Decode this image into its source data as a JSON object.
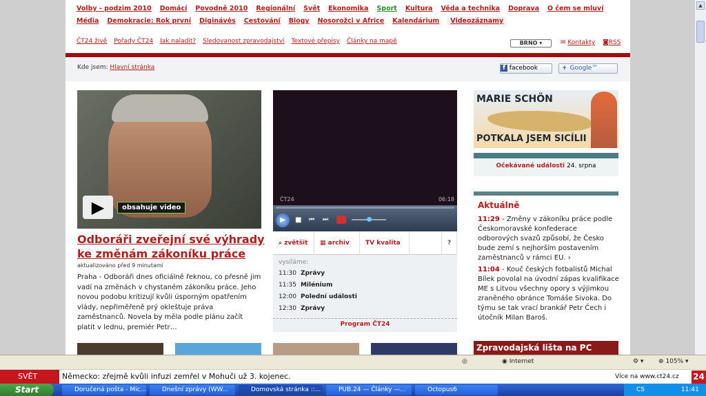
{
  "topnav1": [
    "Volby - podzim 2010",
    "Domácí",
    "Povodně 2010",
    "Regionální",
    "Svět",
    "Ekonomika",
    "Sport",
    "Kultura",
    "Věda a technika",
    "Doprava",
    "O čem se mluví"
  ],
  "topnav2": [
    "Média",
    "Demokracie: Rok první",
    "Diginávės",
    "Cestování",
    "Blogy",
    "Nosorožci v Africe",
    "Kalendárium",
    "Videozáznamy"
  ],
  "subnav": [
    "ČT24 živě",
    "Pořady ČT24",
    "Jak naladit?",
    "Sledovanost zpravodajství",
    "Textové přepisy",
    "Články na mapě"
  ],
  "region": "BRNO",
  "contacts": "Kontakty",
  "rss": "RSS",
  "crumb": {
    "label": "Kde jsem:",
    "link": "Hlavní stránka"
  },
  "share": {
    "facebook": "facebook",
    "google": "Google™"
  },
  "hero": {
    "badge": "obsahuje video",
    "title": "Odboráři zveřejní své výhrady ke změnám zákoníku práce",
    "updated": "aktualizováno před 9 minutami",
    "text": "Praha - Odboráři dnes oficiálně řeknou, co přesně jim vadí na změnách v chystaném zákoníku práce. Jeho novou podobu kritizují kvůli úsporným opatřením vlády, nepřiměřeně prý okleštuje práva zaměstnanců. Novela by měla podle plánu začít platit v lednu, premiér Petr…"
  },
  "player": {
    "channel": "ČT24",
    "time": "06:18"
  },
  "tools": [
    "zvětšit",
    "archiv",
    "TV kvalita",
    "?"
  ],
  "schedule": {
    "heading": "vysíláme:",
    "rows": [
      {
        "t": "11:30",
        "n": "Zprávy"
      },
      {
        "t": "11:35",
        "n": "Milénium"
      },
      {
        "t": "12:00",
        "n": "Polední události"
      },
      {
        "t": "12:30",
        "n": "Zprávy"
      }
    ],
    "link": "Program ČT24"
  },
  "promo": {
    "name": "MARIE SCHÖN",
    "caption": "POTKALA JSEM SICÍLII"
  },
  "events": {
    "label": "Očekávané události",
    "date": "24. srpna"
  },
  "aktualne": {
    "title": "Aktuálně",
    "items": [
      {
        "time": "11:29",
        "text": "Změny v zákoníku práce podle Českomoravské konfederace odborových svazů způsobí, že Česko bude zemí s nejhorším postavením zaměstnanců v rámci EU."
      },
      {
        "time": "11:04",
        "text": "Kouč českých fotbalistů Michal Bílek povolal na úvodní zápas kvalifikace ME s Litvou všechny opory s výjimkou zraněného obránce Tomáše Sivoka. Do týmu se tak vrací brankář Petr Čech i útočník Milan Baroš."
      }
    ]
  },
  "banner": "Zpravodajská lišta na PC",
  "status": {
    "zone": "Internet",
    "zoom": "105%"
  },
  "ticker": {
    "label": "SVĚT",
    "text": "Německo: zřejmě kvůli infuzi zemřel v Mohuči už 3. kojenec.",
    "more": "Více na www.ct24.cz",
    "logo": "24"
  },
  "taskbar": {
    "start": "Start",
    "tasks": [
      "Doručená pošta - Mic...",
      "Dnešní zprávy (WW...",
      "Domovská stránka ::...",
      "PUB.24 — Články —...",
      "Octopus6"
    ],
    "lang": "CS",
    "clock": "11:41"
  }
}
